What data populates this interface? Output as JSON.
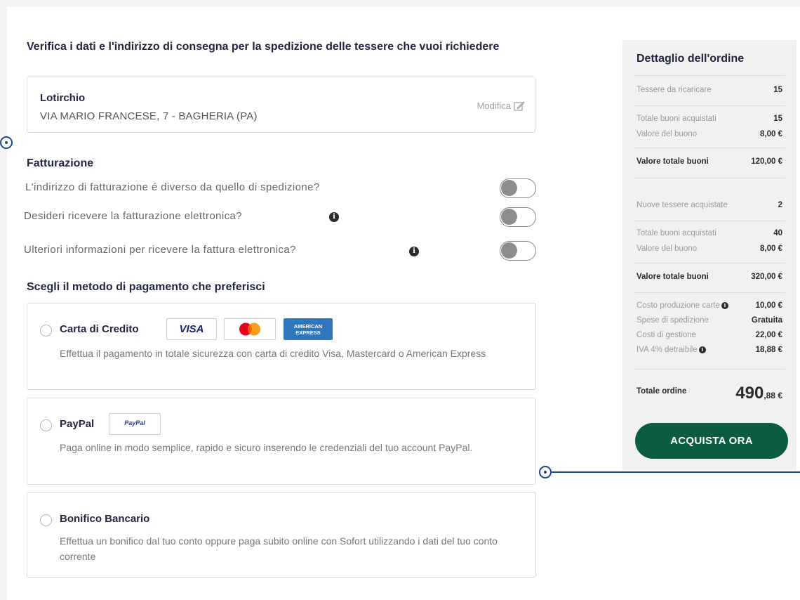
{
  "shipping": {
    "title": "Verifica i dati e l'indirizzo di consegna per la spedizione delle tessere che vuoi richiedere",
    "name": "Lotirchio",
    "address": "VIA MARIO FRANCESE, 7 - BAGHERIA (PA)",
    "edit_label": "Modifica"
  },
  "billing": {
    "title": "Fatturazione",
    "options": [
      {
        "label": "L'indirizzo di fatturazione é diverso da quello di spedizione?",
        "checked": false
      },
      {
        "label": "Desideri ricevere la fatturazione elettronica?",
        "checked": false
      },
      {
        "label": "Ulteriori informazioni per ricevere la fattura elettronica?",
        "checked": false
      }
    ]
  },
  "payment": {
    "title": "Scegli il metodo di pagamento che preferisci",
    "methods": [
      {
        "label": "Carta di Credito",
        "description": "Effettua il pagamento in totale sicurezza con carta di credito Visa, Mastercard o American Express"
      },
      {
        "label": "PayPal",
        "description": "Paga online in modo semplice, rapido e sicuro inserendo le credenziali del tuo account PayPal."
      },
      {
        "label": "Bonifico Bancario",
        "description": "Effettua un bonifico dal tuo conto oppure paga subito online con Sofort utilizzando i dati del tuo conto corrente"
      }
    ],
    "logos": {
      "visa": "VISA",
      "amex_top": "AMERICAN",
      "amex_bottom": "EXPRESS",
      "paypal": "PayPal"
    }
  },
  "summary": {
    "title": "Dettaglio dell'ordine",
    "recharge_label": "Tessere da ricaricare",
    "recharge_value": "15",
    "total_vouchers_label_1": "Totale buoni acquistati",
    "total_vouchers_value_1": "15",
    "voucher_value_label_1": "Valore del buono",
    "voucher_value_1": "8,00 €",
    "total_value_label_1": "Valore totale buoni",
    "total_value_1": "120,00 €",
    "new_cards_label": "Nuove tessere acquistate",
    "new_cards_value": "2",
    "total_vouchers_label_2": "Totale buoni acquistati",
    "total_vouchers_value_2": "40",
    "voucher_value_label_2": "Valore del buono",
    "voucher_value_2": "8,00 €",
    "total_value_label_2": "Valore totale buoni",
    "total_value_2": "320,00 €",
    "production_label": "Costo produzione carte",
    "production_value": "10,00 €",
    "shipping_label": "Spese di spedizione",
    "shipping_value": "Gratuita",
    "management_label": "Costi di gestione",
    "management_value": "22,00 €",
    "vat_label": "IVA 4% detraibile",
    "vat_value": "18,88 €",
    "order_total_label": "Totale ordine",
    "order_total_int": "490",
    "order_total_dec": ",88 €",
    "buy_button": "ACQUISTA ORA"
  },
  "colors": {
    "primary_button": "#0c5c44",
    "title_navy": "#232643",
    "step_blue": "#1b4a8a"
  }
}
